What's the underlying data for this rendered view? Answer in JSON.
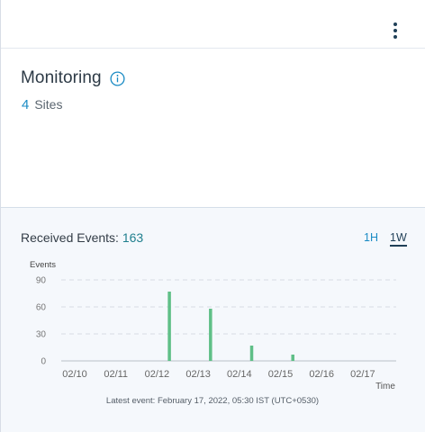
{
  "card": {
    "title": "Monitoring",
    "sites_count": "4",
    "sites_label": "Sites"
  },
  "events": {
    "label": "Received Events:",
    "count": "163",
    "range_1h": "1H",
    "range_1w": "1W",
    "latest": "Latest event: February 17, 2022, 05:30 IST (UTC+0530)"
  },
  "chart_data": {
    "type": "bar",
    "ylabel": "Events",
    "xlabel": "Time",
    "ylim": [
      0,
      90
    ],
    "yticks": [
      0,
      30,
      60,
      90
    ],
    "categories": [
      "02/10",
      "02/11",
      "02/12",
      "02/13",
      "02/14",
      "02/15",
      "02/16",
      "02/17"
    ],
    "bars": [
      {
        "x": 2.3,
        "value": 77
      },
      {
        "x": 3.3,
        "value": 58
      },
      {
        "x": 4.3,
        "value": 17
      },
      {
        "x": 5.3,
        "value": 7
      }
    ],
    "bar_color": "#5fbf87",
    "grid": true
  },
  "colors": {
    "accent": "#1a8bc4",
    "count_teal": "#1f7f8e",
    "bar": "#5fbf87"
  }
}
